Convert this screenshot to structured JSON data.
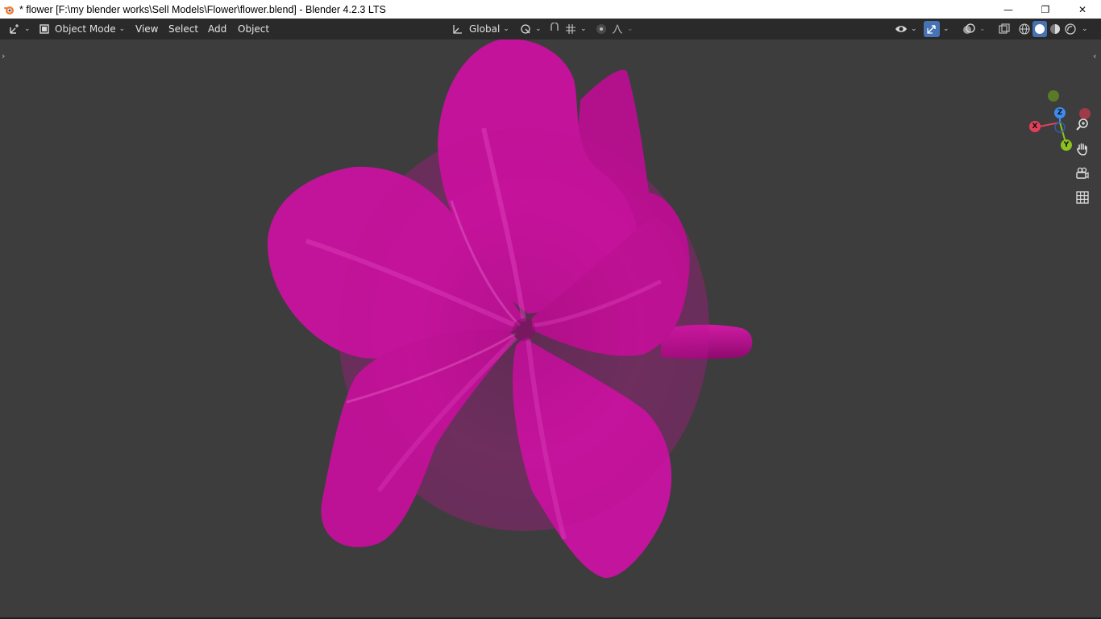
{
  "window": {
    "title": "* flower [F:\\my blender works\\Sell Models\\Flower\\flower.blend] - Blender 4.2.3 LTS",
    "minimize": "—",
    "maximize": "❐",
    "close": "✕"
  },
  "header": {
    "editor_type_icon": "axis-cursor-icon",
    "mode": "Object Mode",
    "menus": [
      "View",
      "Select",
      "Add",
      "Object"
    ],
    "transform_orientation": "Global",
    "pivot_icon": "pivot-icon",
    "snap_icon": "magnet-icon",
    "snap_target_icon": "snap-increment-icon",
    "proportional_icon": "proportional-icon",
    "falloff_icon": "falloff-curve-icon",
    "visibility_icon": "eye-icon",
    "gizmo_icon": "gizmo-icon",
    "overlay_icon": "overlay-icon",
    "xray_icon": "xray-icon",
    "shading_icons": [
      "wireframe-icon",
      "solid-icon",
      "material-preview-icon",
      "rendered-icon"
    ]
  },
  "gizmo": {
    "axes": {
      "x": "X",
      "y": "Y",
      "z": "Z"
    },
    "colors": {
      "x": "#e2405a",
      "y": "#8bc21f",
      "z": "#3d8bf0",
      "neg_x": "#a03a48",
      "neg_y": "#5c7a26",
      "neg_z": "#2f5fa6"
    }
  },
  "navigation": [
    "zoom-icon",
    "pan-hand-icon",
    "camera-icon",
    "grid-ortho-icon"
  ],
  "scene": {
    "object": "flower",
    "color": "#c8129c"
  },
  "colors": {
    "viewport_bg": "#3d3d3d",
    "header_bg": "#2a2a2a",
    "accent": "#4772b3"
  }
}
